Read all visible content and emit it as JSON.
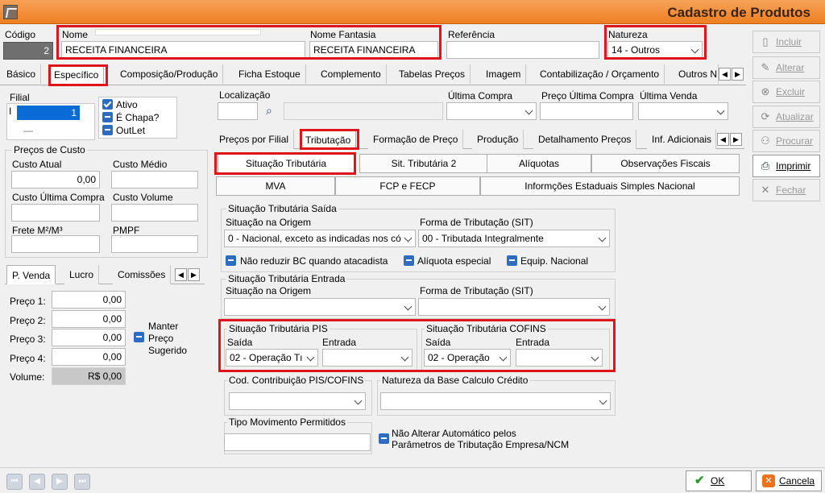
{
  "window": {
    "title": "Cadastro de Produtos"
  },
  "header": {
    "codigo_label": "Código",
    "codigo_value": "2",
    "nome_label": "Nome",
    "nome_value": "RECEITA FINANCEIRA",
    "fantasia_label": "Nome Fantasia",
    "fantasia_value": "RECEITA FINANCEIRA",
    "referencia_label": "Referência",
    "referencia_value": "",
    "natureza_label": "Natureza",
    "natureza_value": "14 - Outros"
  },
  "main_tabs": [
    "Básico",
    "Específico",
    "Composição/Produção",
    "Ficha Estoque",
    "Complemento",
    "Tabelas Preços",
    "Imagem",
    "Contabilização / Orçamento",
    "Outros N"
  ],
  "left": {
    "filial_label": "Filial",
    "filial_value": "1",
    "filial_dash": "—",
    "checks": [
      "Ativo",
      "É Chapa?",
      "OutLet"
    ],
    "precos_custo_title": "Preços de Custo",
    "custo_atual_label": "Custo Atual",
    "custo_atual_value": "0,00",
    "custo_medio_label": "Custo Médio",
    "custo_ultima_label": "Custo Última Compra",
    "custo_volume_label": "Custo Volume",
    "frete_label": "Frete M²/M³",
    "pmpf_label": "PMPF",
    "price_tabs": [
      "P. Venda",
      "Lucro",
      "Comissões"
    ],
    "precos": [
      {
        "label": "Preço 1:",
        "value": "0,00"
      },
      {
        "label": "Preço 2:",
        "value": "0,00"
      },
      {
        "label": "Preço 3:",
        "value": "0,00"
      },
      {
        "label": "Preço 4:",
        "value": "0,00"
      }
    ],
    "volume_label": "Volume:",
    "volume_value": "R$ 0,00",
    "manter_label_1": "Manter",
    "manter_label_2": "Preço",
    "manter_label_3": "Sugerido"
  },
  "center": {
    "localizacao_label": "Localização",
    "ultima_compra_label": "Última Compra",
    "preco_ultima_label": "Preço Última Compra",
    "ultima_venda_label": "Última Venda",
    "sub_tabs": [
      "Preços por Filial",
      "Tributação",
      "Formação de Preço",
      "Produção",
      "Detalhamento Preços",
      "Inf. Adicionais"
    ],
    "trib_buttons_row1": [
      "Situação Tributária",
      "Sit. Tributária 2",
      "Alíquotas",
      "Observações Fiscais"
    ],
    "trib_buttons_row2": [
      "MVA",
      "FCP e FECP",
      "Informções Estaduais Simples Nacional"
    ],
    "saida_group": "Situação Tributária Saída",
    "origem_label": "Situação na Origem",
    "origem_value": "0 - Nacional, exceto as indicadas nos có",
    "forma_label": "Forma de Tributação (SIT)",
    "forma_value": "00 - Tributada Integralmente",
    "saida_checks": [
      "Não reduzir BC quando atacadista",
      "Alíquota especial",
      "Equip. Nacional"
    ],
    "entrada_group": "Situação Tributária Entrada",
    "entrada_origem_label": "Situação na Origem",
    "entrada_forma_label": "Forma de Tributação (SIT)",
    "pis_group": "Situação Tributária PIS",
    "pis_saida_label": "Saída",
    "pis_saida_value": "02 - Operação Tı",
    "pis_entrada_label": "Entrada",
    "cofins_group": "Situação Tributária COFINS",
    "cofins_saida_label": "Saída",
    "cofins_saida_value": "02 - Operação",
    "cofins_entrada_label": "Entrada",
    "cod_contrib_group": "Cod. Contribuição PIS/COFINS",
    "natureza_base_group": "Natureza da Base Calculo Crédito",
    "tipo_mov_group": "Tipo Movimento Permitidos",
    "nao_alterar_line1": "Não Alterar Automático pelos",
    "nao_alterar_line2": "Parâmetros de Tributação Empresa/NCM"
  },
  "side_buttons": [
    {
      "label": "Incluir",
      "icon": "document-icon",
      "enabled": false
    },
    {
      "label": "Alterar",
      "icon": "pencil-icon",
      "enabled": false
    },
    {
      "label": "Excluir",
      "icon": "delete-icon",
      "enabled": false
    },
    {
      "label": "Atualizar",
      "icon": "refresh-icon",
      "enabled": false
    },
    {
      "label": "Procurar",
      "icon": "binoculars-icon",
      "enabled": false
    },
    {
      "label": "Imprimir",
      "icon": "printer-icon",
      "enabled": true
    },
    {
      "label": "Fechar",
      "icon": "close-icon",
      "enabled": false
    }
  ],
  "footer": {
    "ok_label": "OK",
    "cancel_label": "Cancela"
  }
}
